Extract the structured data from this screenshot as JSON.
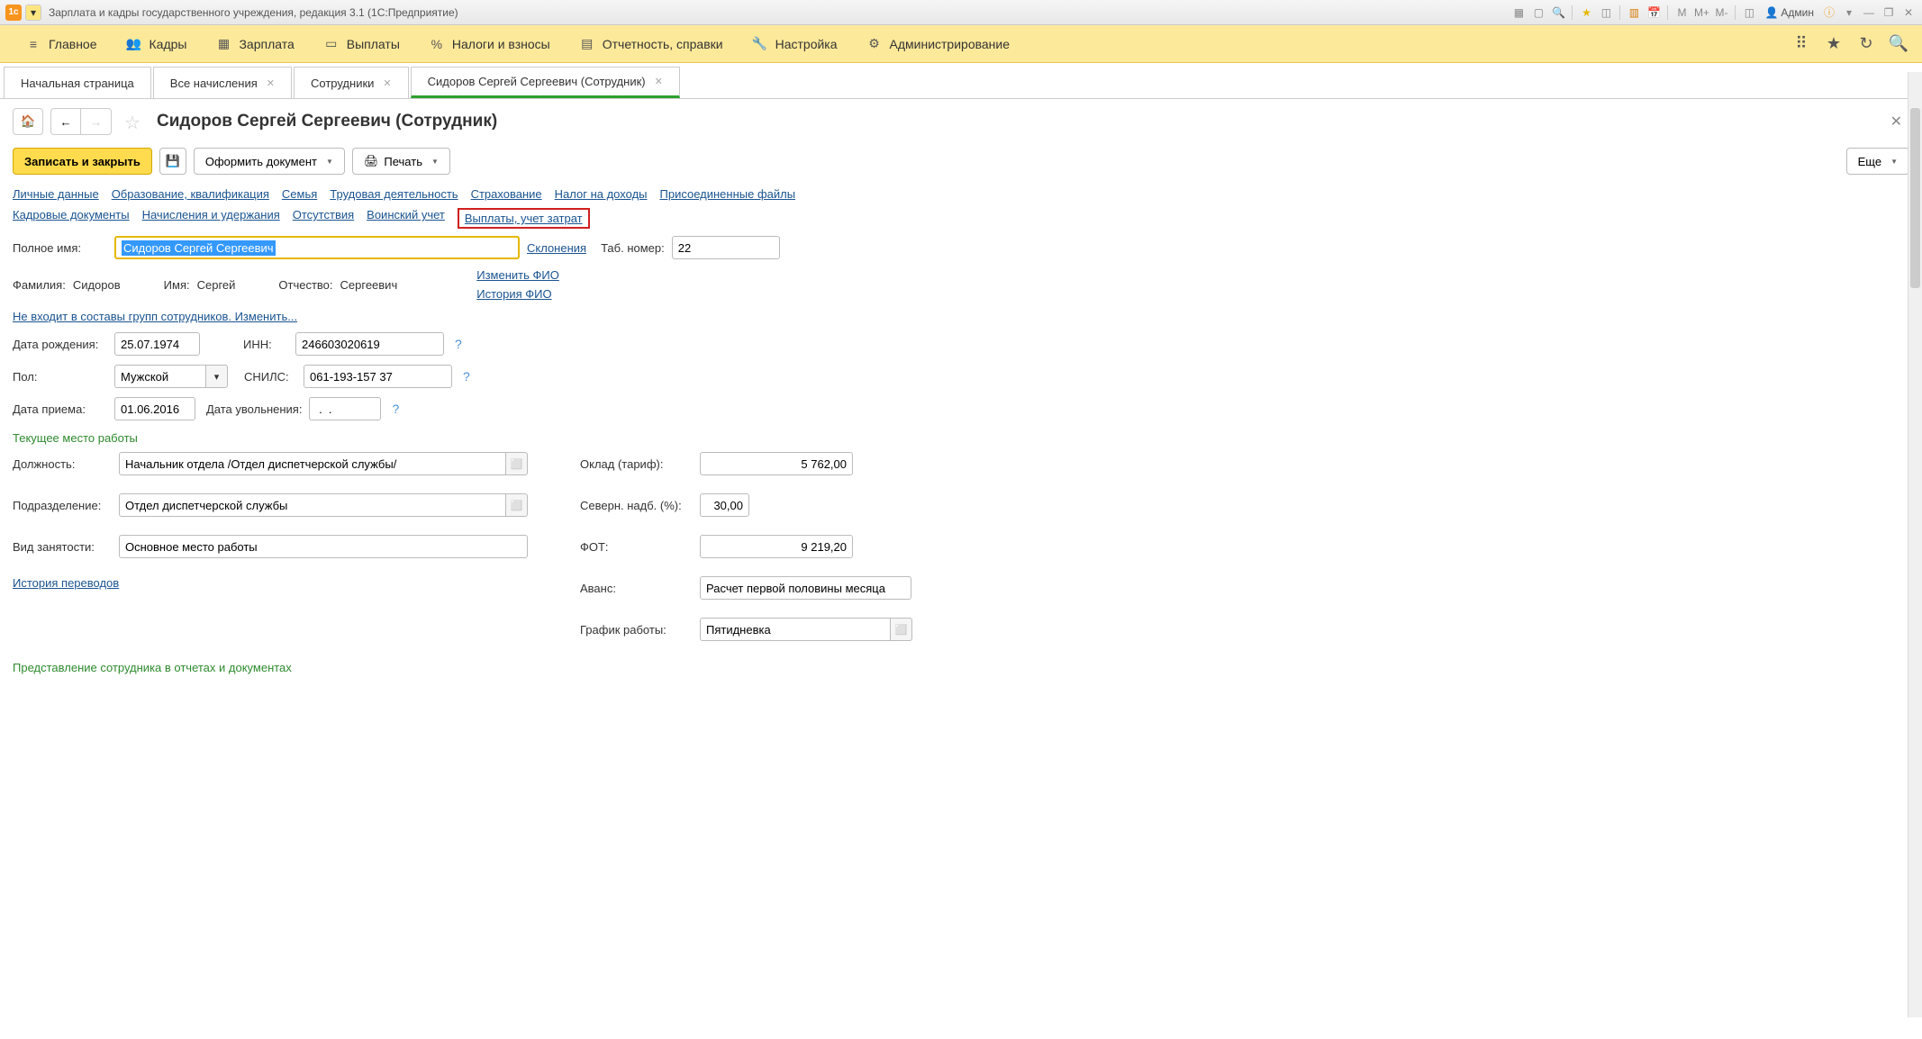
{
  "titlebar": {
    "title": "Зарплата и кадры государственного учреждения, редакция 3.1  (1С:Предприятие)",
    "admin": "Админ"
  },
  "menu": {
    "main": "Главное",
    "personnel": "Кадры",
    "salary": "Зарплата",
    "payments": "Выплаты",
    "taxes": "Налоги и взносы",
    "reports": "Отчетность, справки",
    "settings": "Настройка",
    "admin": "Администрирование"
  },
  "tabs": {
    "start": "Начальная страница",
    "calcs": "Все начисления",
    "employees": "Сотрудники",
    "current": "Сидоров Сергей Сергеевич (Сотрудник)"
  },
  "page": {
    "title": "Сидоров Сергей Сергеевич (Сотрудник)"
  },
  "toolbar": {
    "save_close": "Записать и закрыть",
    "create_doc": "Оформить документ",
    "print": "Печать",
    "more": "Еще"
  },
  "links": {
    "personal": "Личные данные",
    "education": "Образование, квалификация",
    "family": "Семья",
    "labor": "Трудовая деятельность",
    "insurance": "Страхование",
    "income_tax": "Налог на доходы",
    "files": "Присоединенные файлы",
    "hr_docs": "Кадровые документы",
    "accruals": "Начисления и удержания",
    "absences": "Отсутствия",
    "military": "Воинский учет",
    "pay_cost": "Выплаты, учет затрат"
  },
  "form": {
    "full_name_label": "Полное имя:",
    "full_name": "Сидоров Сергей Сергеевич",
    "declensions": "Склонения",
    "tab_no_label": "Таб. номер:",
    "tab_no": "22",
    "surname_label": "Фамилия:",
    "surname": "Сидоров",
    "name_label": "Имя:",
    "name": "Сергей",
    "patronymic_label": "Отчество:",
    "patronymic": "Сергеевич",
    "change_fio": "Изменить ФИО",
    "history_fio": "История ФИО",
    "not_in_groups": "Не входит в составы групп сотрудников. Изменить...",
    "birth_label": "Дата рождения:",
    "birth": "25.07.1974",
    "inn_label": "ИНН:",
    "inn": "246603020619",
    "gender_label": "Пол:",
    "gender": "Мужской",
    "snils_label": "СНИЛС:",
    "snils": "061-193-157 37",
    "hire_label": "Дата приема:",
    "hire": "01.06.2016",
    "fire_label": "Дата увольнения:",
    "fire": " .  .    ",
    "workplace_section": "Текущее место работы",
    "position_label": "Должность:",
    "position": "Начальник отдела /Отдел диспетчерской службы/",
    "department_label": "Подразделение:",
    "department": "Отдел диспетчерской службы",
    "employment_label": "Вид занятости:",
    "employment": "Основное место работы",
    "transfers_history": "История переводов",
    "salary_label": "Оклад (тариф):",
    "salary": "5 762,00",
    "north_label": "Северн. надб. (%):",
    "north": "30,00",
    "fot_label": "ФОТ:",
    "fot": "9 219,20",
    "advance_label": "Аванс:",
    "advance": "Расчет первой половины месяца",
    "schedule_label": "График работы:",
    "schedule": "Пятидневка",
    "representation_section": "Представление сотрудника в отчетах и документах"
  }
}
